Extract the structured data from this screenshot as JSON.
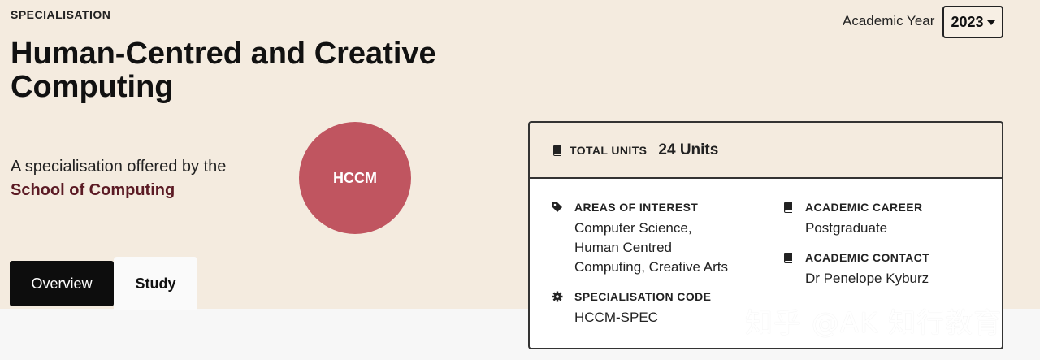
{
  "header": {
    "eyebrow": "SPECIALISATION",
    "title": "Human-Centred and Creative Computing",
    "offered_prefix": "A specialisation offered by the",
    "school": "School of Computing",
    "badge": "HCCM"
  },
  "year": {
    "label": "Academic Year",
    "value": "2023"
  },
  "tabs": [
    {
      "label": "Overview",
      "active": true
    },
    {
      "label": "Study",
      "active": false
    }
  ],
  "card": {
    "total_units_label": "TOTAL UNITS",
    "total_units_value": "24 Units",
    "areas_label": "AREAS OF INTEREST",
    "areas_lines": [
      "Computer Science,",
      "Human Centred",
      "Computing, Creative Arts"
    ],
    "code_label": "SPECIALISATION CODE",
    "code_value": "HCCM-SPEC",
    "career_label": "ACADEMIC CAREER",
    "career_value": "Postgraduate",
    "contact_label": "ACADEMIC CONTACT",
    "contact_value": "Dr Penelope Kyburz"
  },
  "watermark": "知乎 @AK 知行教育",
  "colors": {
    "background": "#f4ebdf",
    "badge": "#c05560",
    "school": "#5b1a24",
    "link": "#1f5aa6"
  },
  "icons": [
    "book-icon",
    "tag-icon",
    "gear-icon",
    "chevron-down-icon"
  ]
}
